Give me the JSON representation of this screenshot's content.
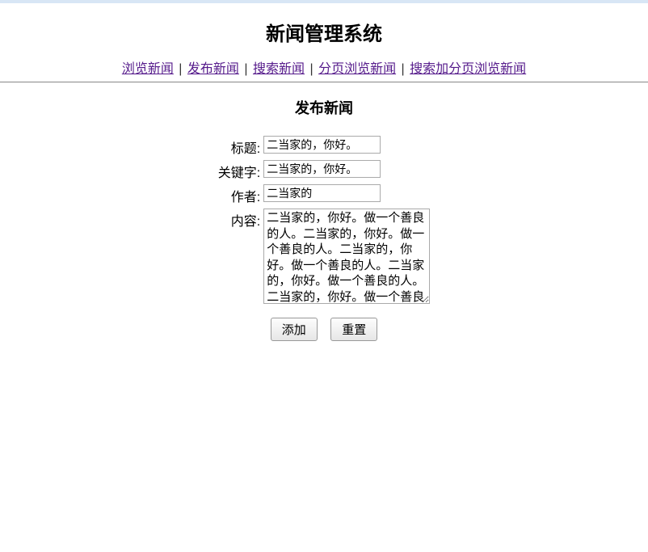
{
  "system_title": "新闻管理系统",
  "nav": {
    "browse": "浏览新闻",
    "publish": "发布新闻",
    "search": "搜索新闻",
    "paged_browse": "分页浏览新闻",
    "search_paged_browse": "搜索加分页浏览新闻",
    "separator": "|"
  },
  "form": {
    "title": "发布新闻",
    "labels": {
      "title": "标题:",
      "keywords": "关键字:",
      "author": "作者:",
      "content": "内容:"
    },
    "values": {
      "title": "二当家的，你好。",
      "keywords": "二当家的，你好。",
      "author": "二当家的",
      "content": "二当家的，你好。做一个善良的人。二当家的，你好。做一个善良的人。二当家的，你好。做一个善良的人。二当家的，你好。做一个善良的人。二当家的，你好。做一个善良的人。"
    },
    "buttons": {
      "submit": "添加",
      "reset": "重置"
    }
  }
}
